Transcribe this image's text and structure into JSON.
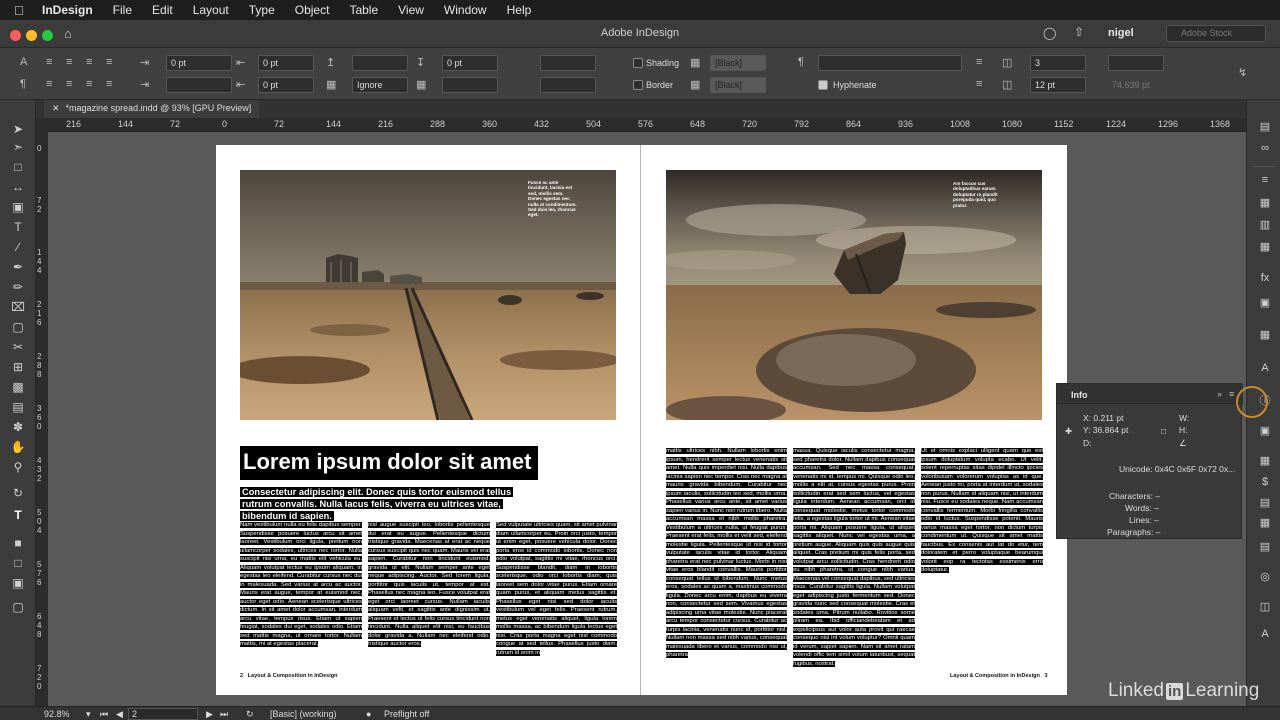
{
  "menubar": {
    "app": "InDesign",
    "items": [
      "File",
      "Edit",
      "Layout",
      "Type",
      "Object",
      "Table",
      "View",
      "Window",
      "Help"
    ]
  },
  "titlebar": {
    "title": "Adobe InDesign",
    "user": "nigel",
    "stock_placeholder": "Adobe Stock"
  },
  "control": {
    "field_pt_1": "0 pt",
    "field_pt_2": "0 pt",
    "field_pt_3": "0 pt",
    "field_pt_4": "0 pt",
    "field_pt_5": "0 pt",
    "ignore": "Ignore",
    "shading_label": "Shading",
    "border_label": "Border",
    "swatch_1": "[Black]",
    "swatch_2": "[Black]",
    "hyphenate_label": "Hyphenate",
    "columns": "3",
    "gutter": "12 pt",
    "grayed_value": "74.639 pt"
  },
  "doc_tab": {
    "label": "*magazine spread.indd @ 93% [GPU Preview]"
  },
  "ruler": {
    "h_ticks": [
      "216",
      "144",
      "72",
      "0",
      "72",
      "144",
      "216",
      "288",
      "360",
      "432",
      "504",
      "576",
      "648",
      "720",
      "792",
      "864",
      "936",
      "1008",
      "1080",
      "1152",
      "1224",
      "1296",
      "1368"
    ],
    "v_ticks": [
      "0",
      "7 2",
      "1 4 4",
      "2 1 6",
      "2 8 8",
      "3 6 0",
      "4 3 2",
      "5 0 4",
      "5 7 6",
      "6 4 8",
      "7 2 0"
    ]
  },
  "spread": {
    "left_caption": "Fusce ac ante tincidunt, lacinia est sed, mollis sem. Donec egestas nec nulla at condimentum. Sed duis leo, rhoncus eget.",
    "right_caption": "Am faccus cus doluptatibus earum doluptatur ra plandit porepuda quid, quo pratur.",
    "heading": "Lorem ipsum dolor sit amet",
    "subhead": "Consectetur adipiscing elit. Donec quis tortor euismod tellus rutrum convallis. Nulla lacus felis, viverra eu ultrices vitae, bibendum id sapien.",
    "col1": "Nam vestibulum nulla eu felis dapibus semper. Suspendisse posuere luctus arcu sit amet laoreet. Vestibulum orci ligula, pretium non ullamcorper sodales, ultrices nec tortor. Nulla suscipit nisi urna, eu mattis elit vehicula eu. Aliquam volutpat lectus eu ipsum aliquam, in egestas leo eleifend. Curabitur cursus nec dui in malesuada. Sed varius at arcu ac auctor. Mauris erat augue, tempor at euismod nec, auctor eget odio. Aenean scelerisque ultrices dictum. In sit amet dolor accumsan, interdum arcu vitae, tempus risus. Etiam ut sapien feugiat, sodales dui eget, sodales odio. Etiam sed mattis magna, ut ornare tortor. Nullam mattis, mi at egestas placerat,",
    "col2": "nisl augue suscipit leo, lobortis pellentesque dui erat eu augue. Pellentesque dictum tristique gravida. Maecenas at erat ac neque cursus suscipit quis nec quam. Mauris vel erat sapien. Curabitur non tincidunt euismod, gravida ut elit. Nullam semper ante eget neque adipiscing. Auctor. Sed lorem ligula, porttitor quis iaculis ut, tempor at est. Phasellus nec magna leo. Fusce volutpat erat eget orci laoreet cursus. Nullam iaculis aliquam velit, et sagittis ante dignissim ut. Praesent et lectus ut felis cursus tincidunt non tincidunt. Nulla aliquet elit nisi, eu faucibus dolor gravida a. Nullam nec eleifend odio, tristique auctor eros.",
    "col3": "Sed vulputate ultricies quam, sit amet pulvinar diam ullamcorper eu. Proin orci justo, tempor ut enim eget, posuere vehicula dolor. Donec porta eros id commodo lobortis. Donec non odio volutpat, sagittis mi vitae, rhoncus orci. Suspendisse blandit, diam in lobortis scelerisque, odio orci lobortis diam, quis laoreet sem dolor vitae purus. Etiam ornare quam purus, et aliquam metus sagittis et. Phasellus eget nisi sed dolor iaculis vestibulum vel eget felis. Praesent rutrum, metus eget venenatis aliquet, ligula lorem mollis massa, ac bibendum ligula lectus eget nisi. Cras porta magna eget nisl commodo congue at sed tellus. Phasellus justo diam, rutrum id enim in",
    "col4": "mattis ultrices nibh. Nullam lobortis enim ipsum, hendrerit semper lectus venenatis sit amet. Nulla quis imperdiet nisi. Nulla dapibus lacinia sapien nec tempor. Cras nec magna at mauris gravida bibendum. Curabitur nec ipsum iaculis, sollicitudin leo sed, mollis urna. Phasellus varius arcu ante, sit amet varius sapien varius in. Nunc non rutrum libero. Nulla accumsan massa et nibh mollis pharetra. Vestibulum a ultrices nulla, ut feugiat purus. Praesent erat felis, mollis et velit sed, eleifend molestie ligula. Pellentesque id nisi id tortor vulputate iaculis vitae id tortor. Aliquam pharetra erat nec pulvinar luctus. Morbi in nisi vitae eros blandit convallis. Mauris porttitor consequat tellus id bibendum. Nunc metus eros, sodales ac quam a, maximus commodo ligula. Donec arcu enim, dapibus eu viverra non, consectetur sed sem. Vivamus egestas adipiscing urna vitae molestie. Nunc placerat arcu tempor consectetur cursus. Curabitur ac turpis lacinia, venenatis nunc id, porttitor nisl. Nullam non massa sed nibh varius, consequat malesuada libero et varius, commodo nisi ut, pharetra",
    "col5": "massa. Quisque iaculis consectetur magna, sed pharetra dolor. Nullam dapibus consequat accumsan. Sed nec massa consequat, venenatis mi id, tempus mi. Quisque odio leo, mollis a elit at, cursus egestas purus. Proin sollicitudin erat sed sem luctus, vel egestas ligula interdum. Aenean accumsan, orci id consequat molestie, metus tortor commodo felis, a egestas ligula tortor ut mi. Aenean vitae porta mi. Aliquam posuere ligula, ut aliquet sagittis aliquet. Nunc vel egestas urna, a pretium augue. Aliquam quis quis augue quis aliquet. Cras pretium mi quis felis porta, sed volutpat arcu sollicitudin. Cras hendrerit odio eu nibh pharetra, ut congue nibh varius. Maecenas vel consequat dapibus, sed ultricies risus. Curabitur sagittis ligula. Nullam volutpat eget adipiscing justo fermentum sed. Donec gravida nunc sed consequat molestie. Cras et sodales uma. Pitrum nullabo. Rovitios some pliram ea. Ibid officiandebeatam et ad expelicipsus aut volor auta provit qui raecae consequo nisi int volum voluptur? Omnii quam id verum, sapiet sapien. Nam sit amet ratam volendi offic tem simil volum laturibust, sequat fugibus, nostrat.",
    "col6": "Ut et omnis explaci ulligent quam que est ipsum doluptatum volupta ecabo. Ut velit, solent reperruptas sitas dipidel illincto ipicies voloribusam volorerum voluptas as id que. Aenean justo mi, porta at interdum ut, sodales non purus. Nullam id aliquam nisi, ut interdum nisi. Fusce eu sodales neque. Nam accumsan convallis fermentum. Morbi fringilla convallis odio id luctus. Suspendisse potenti. Mauris varius massa eget tortor, non dictum turpis condimentum ut. Quisque sit amet mattis faucibus. Ex consenis aut lat do etur, tem doloratem et perro voluptaque bearumqui volorit eop ra tectotas essimenis erro doluptatur.",
    "folio_left_num": "2",
    "folio_left_text": "Layout & Composition in InDesign",
    "folio_right_text": "Layout & Composition in InDesign",
    "folio_right_num": "3"
  },
  "info_panel": {
    "title": "Info",
    "x": "X: 0.211 pt",
    "y": "Y: 36.864 pt",
    "d": "D:",
    "w": "W:",
    "h": "H:",
    "unicode": "Unicode: 0x4C 0x6F 0x72 0x...",
    "characters": "Characters: –",
    "words": "Words: –",
    "lines": "Lines: –",
    "paragraphs": "Paragraphs: –"
  },
  "status": {
    "zoom": "92.8%",
    "page": "2",
    "style": "[Basic] (working)",
    "preflight": "Preflight off"
  },
  "watermark": {
    "left": "Linked",
    "in": "in",
    "right": "Learning"
  },
  "colors": {
    "accent": "#c98a2a",
    "menubar": "#1e1e1e",
    "panel": "#3c3c3c",
    "pasteboard": "#5a5a5a"
  }
}
